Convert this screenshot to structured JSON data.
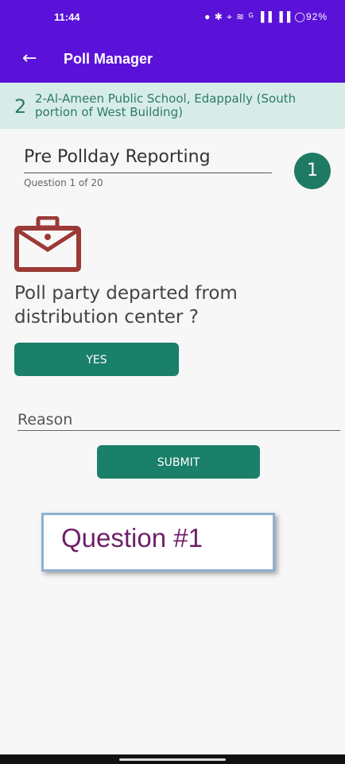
{
  "status": {
    "time": "11:44",
    "icons": "● ✱ ⌖ ≋ ᴳ ▐▐ ▐▐ ◯92%",
    "battery": "92%"
  },
  "appbar": {
    "back_icon": "←",
    "title": "Poll Manager"
  },
  "booth": {
    "number": "2",
    "name": "2-Al-Ameen Public School, Edappally (South portion of West Building)"
  },
  "section": {
    "title": "Pre Pollday Reporting",
    "question_count": "Question 1 of 20",
    "step_number": "1"
  },
  "question": {
    "icon": "briefcase-icon",
    "text": "Poll party departed from distribution center ?"
  },
  "buttons": {
    "yes": "YES",
    "submit": "SUBMIT"
  },
  "reason": {
    "placeholder": "Reason"
  },
  "callout": {
    "text": "Question #1"
  },
  "colors": {
    "appbar": "#5a12d8",
    "accent": "#1a8069",
    "booth_bg": "#d7ece7",
    "icon": "#9b3a36"
  }
}
